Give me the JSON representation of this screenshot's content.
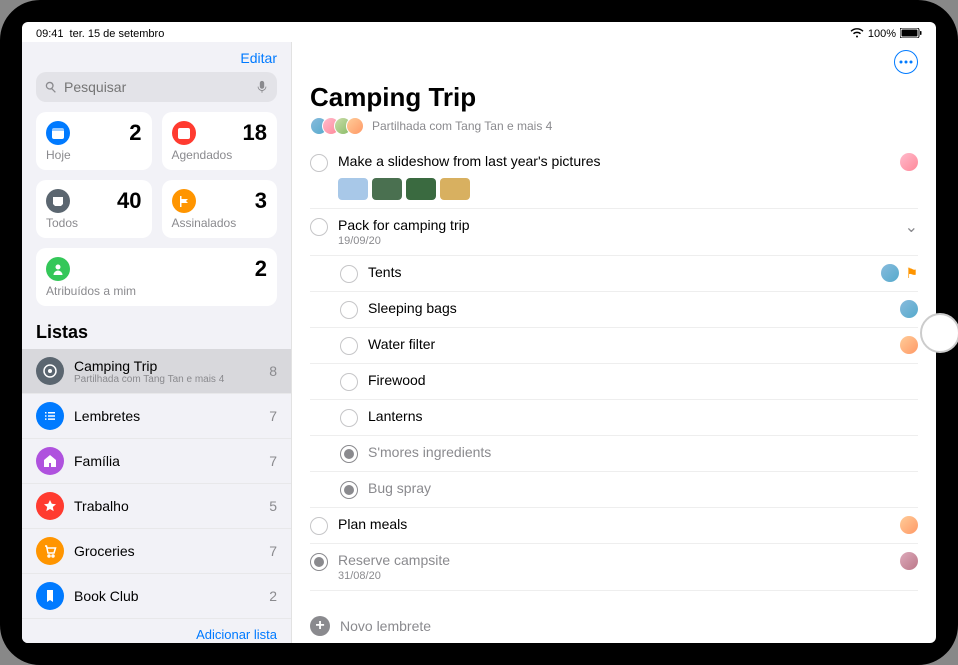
{
  "statusbar": {
    "time": "09:41",
    "date": "ter. 15 de setembro",
    "battery": "100%"
  },
  "sidebar": {
    "edit": "Editar",
    "search_placeholder": "Pesquisar",
    "cards": {
      "today": {
        "label": "Hoje",
        "count": "2",
        "color": "#007aff"
      },
      "scheduled": {
        "label": "Agendados",
        "count": "18",
        "color": "#ff3b30"
      },
      "all": {
        "label": "Todos",
        "count": "40",
        "color": "#5b6670"
      },
      "flagged": {
        "label": "Assinalados",
        "count": "3",
        "color": "#ff9500"
      },
      "assigned": {
        "label": "Atribuídos a mim",
        "count": "2",
        "color": "#34c759"
      }
    },
    "lists_header": "Listas",
    "lists": [
      {
        "title": "Camping Trip",
        "sub": "Partilhada com Tang Tan e mais 4",
        "count": "8",
        "color": "#5b6670",
        "selected": true,
        "icon": "bullseye"
      },
      {
        "title": "Lembretes",
        "count": "7",
        "color": "#007aff",
        "icon": "list"
      },
      {
        "title": "Família",
        "count": "7",
        "color": "#af52de",
        "icon": "home"
      },
      {
        "title": "Trabalho",
        "count": "5",
        "color": "#ff3b30",
        "icon": "star"
      },
      {
        "title": "Groceries",
        "count": "7",
        "color": "#ff9500",
        "icon": "cart"
      },
      {
        "title": "Book Club",
        "count": "2",
        "color": "#007aff",
        "icon": "bookmark"
      }
    ],
    "add_list": "Adicionar lista"
  },
  "content": {
    "title": "Camping Trip",
    "shared_text": "Partilhada com Tang Tan e mais 4",
    "reminders": [
      {
        "title": "Make a slideshow from last year's pictures",
        "avatar": "a2",
        "thumbs": [
          "#a8c8e8",
          "#4a7050",
          "#3a6a40",
          "#d8b060"
        ]
      },
      {
        "title": "Pack for camping trip",
        "date": "19/09/20",
        "expand": true,
        "subs": [
          {
            "title": "Tents",
            "avatar": "a1",
            "flag": true
          },
          {
            "title": "Sleeping bags",
            "avatar": "a1"
          },
          {
            "title": "Water filter",
            "avatar": "a4"
          },
          {
            "title": "Firewood"
          },
          {
            "title": "Lanterns"
          },
          {
            "title": "S'mores ingredients",
            "done": true
          },
          {
            "title": "Bug spray",
            "done": true
          }
        ]
      },
      {
        "title": "Plan meals",
        "avatar": "a4"
      },
      {
        "title": "Reserve campsite",
        "date": "31/08/20",
        "done": true,
        "avatar": "a5"
      }
    ],
    "new_reminder": "Novo lembrete"
  }
}
